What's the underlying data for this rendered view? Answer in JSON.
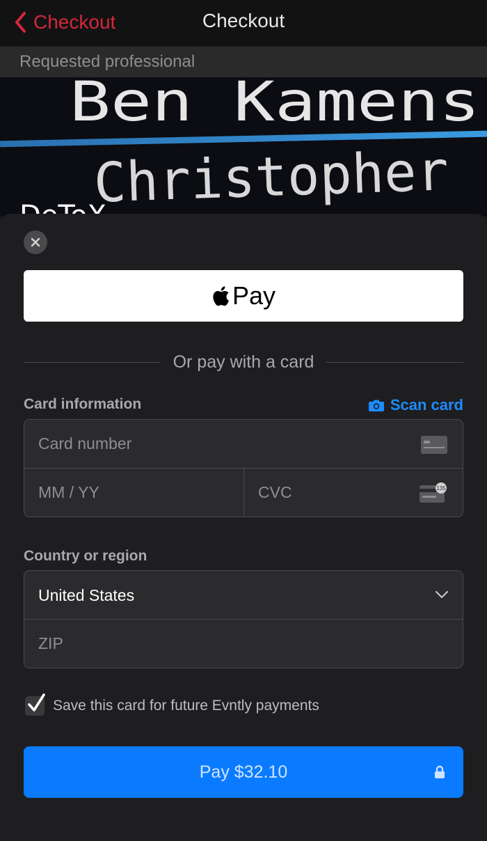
{
  "navbar": {
    "back_label": "Checkout",
    "title": "Checkout"
  },
  "subheader": "Requested professional",
  "background_text": [
    "Ben Kamens",
    "Christopher",
    "DeToX"
  ],
  "payment_sheet": {
    "apple_pay_label": "Pay",
    "divider_text": "Or pay with a card",
    "card_section_label": "Card information",
    "scan_card_label": "Scan card",
    "card_number_placeholder": "Card number",
    "expiry_placeholder": "MM / YY",
    "cvc_placeholder": "CVC",
    "cvc_icon_text": "135",
    "country_section_label": "Country or region",
    "country_value": "United States",
    "zip_placeholder": "ZIP",
    "save_card_label": "Save this card for future Evntly payments",
    "save_card_checked": true,
    "pay_button_label": "Pay $32.10"
  },
  "colors": {
    "accent_red": "#d2283c",
    "accent_blue": "#0a7bff",
    "sheet_bg": "#1e1e20"
  }
}
